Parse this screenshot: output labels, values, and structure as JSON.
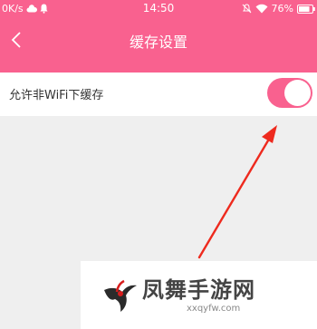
{
  "status": {
    "speed": "0K/s",
    "time": "14:50",
    "battery": "76%"
  },
  "nav": {
    "title": "缓存设置",
    "back_icon": "chevron-left-icon"
  },
  "setting": {
    "label": "允许非WiFi下缓存",
    "toggle_on": true
  },
  "watermark": {
    "name": "凤舞手游网",
    "url": "xxqyfw.com"
  },
  "colors": {
    "accent": "#f9618f",
    "arrow": "#ee2a1e",
    "background": "#efefef"
  }
}
